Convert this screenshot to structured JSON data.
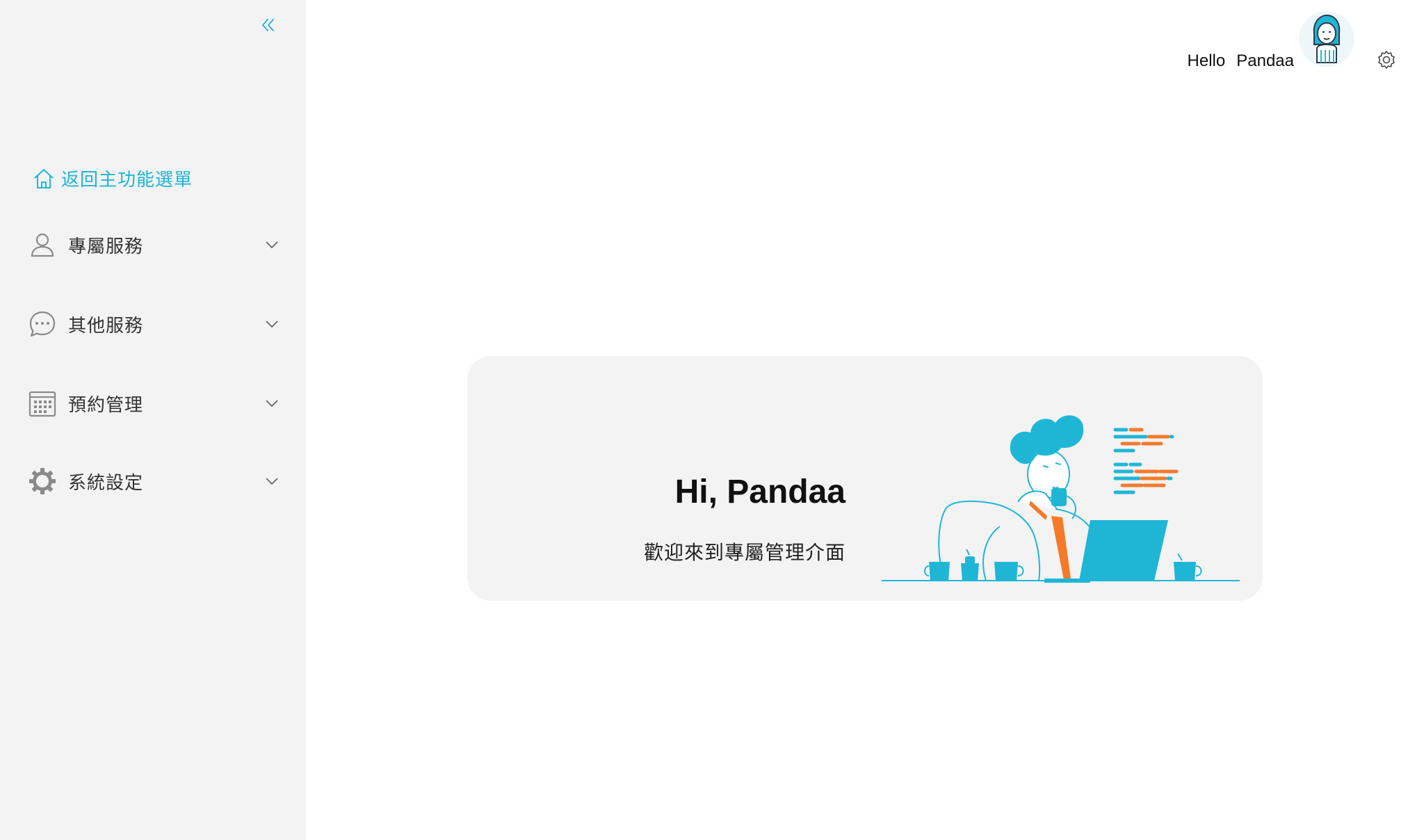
{
  "sidebar": {
    "home_label": "返回主功能選單",
    "items": [
      {
        "label": "專屬服務",
        "icon": "user-icon"
      },
      {
        "label": "其他服務",
        "icon": "chat-bubble-icon"
      },
      {
        "label": "預約管理",
        "icon": "calendar-icon"
      },
      {
        "label": "系統設定",
        "icon": "gear-icon"
      }
    ]
  },
  "header": {
    "hello": "Hello",
    "username": "Pandaa"
  },
  "card": {
    "title": "Hi, Pandaa",
    "subtitle": "歡迎來到專屬管理介面"
  },
  "colors": {
    "accent": "#1fb6d6",
    "orange": "#f47a2a",
    "sidebar_bg": "#f3f3f3",
    "card_bg": "#f3f3f3"
  }
}
